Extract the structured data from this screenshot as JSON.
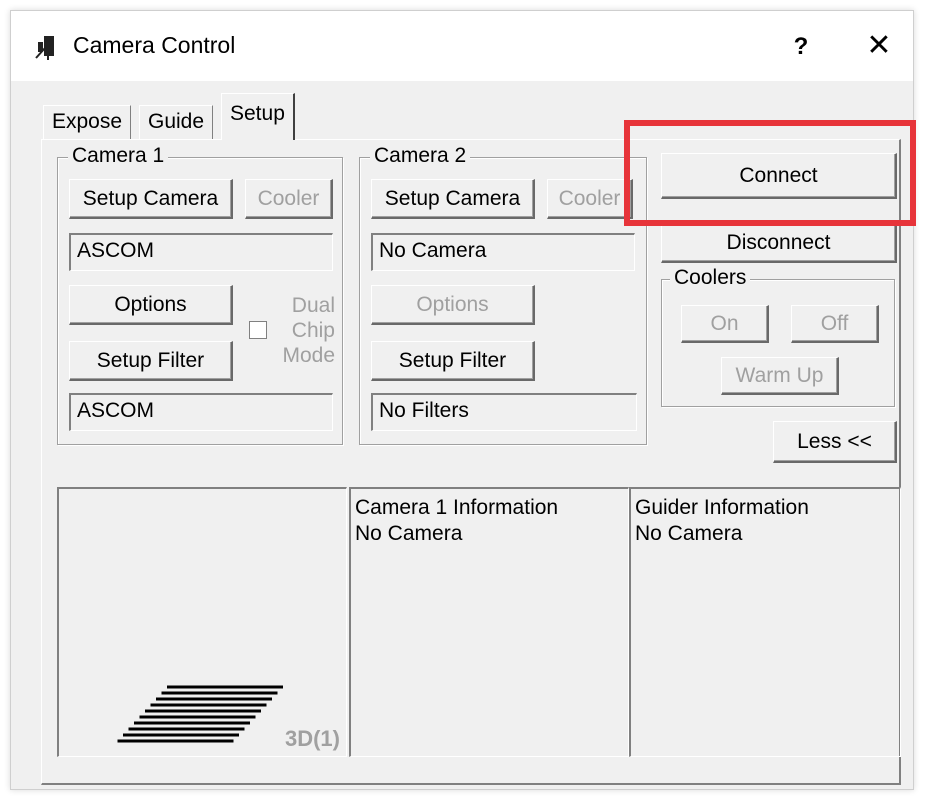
{
  "window": {
    "title": "Camera Control",
    "help_label": "?",
    "close_label": "✕",
    "icon": "camera-control-icon"
  },
  "tabs": [
    {
      "label": "Expose",
      "active": false
    },
    {
      "label": "Guide",
      "active": false
    },
    {
      "label": "Setup",
      "active": true
    }
  ],
  "camera1": {
    "group_label": "Camera 1",
    "setup_camera_label": "Setup Camera",
    "cooler_label": "Cooler",
    "camera_value": "ASCOM",
    "options_label": "Options",
    "dual_chip_line1": "Dual",
    "dual_chip_line2": "Chip",
    "dual_chip_line3": "Mode",
    "dual_chip_checked": false,
    "setup_filter_label": "Setup Filter",
    "filter_value": "ASCOM"
  },
  "camera2": {
    "group_label": "Camera 2",
    "setup_camera_label": "Setup Camera",
    "cooler_label": "Cooler",
    "camera_value": "No Camera",
    "options_label": "Options",
    "setup_filter_label": "Setup Filter",
    "filter_value": "No Filters"
  },
  "connection": {
    "connect_label": "Connect",
    "disconnect_label": "Disconnect"
  },
  "coolers": {
    "group_label": "Coolers",
    "on_label": "On",
    "off_label": "Off",
    "warm_up_label": "Warm Up"
  },
  "less_label": "Less <<",
  "preview": {
    "status_label": "3D(1)"
  },
  "info": {
    "camera1_title": "Camera 1 Information",
    "camera1_status": "No Camera",
    "guider_title": "Guider Information",
    "guider_status": "No Camera"
  },
  "colors": {
    "highlight": "#e7343a",
    "panel_bg": "#f0f0f0",
    "disabled_text": "#a0a0a0"
  }
}
